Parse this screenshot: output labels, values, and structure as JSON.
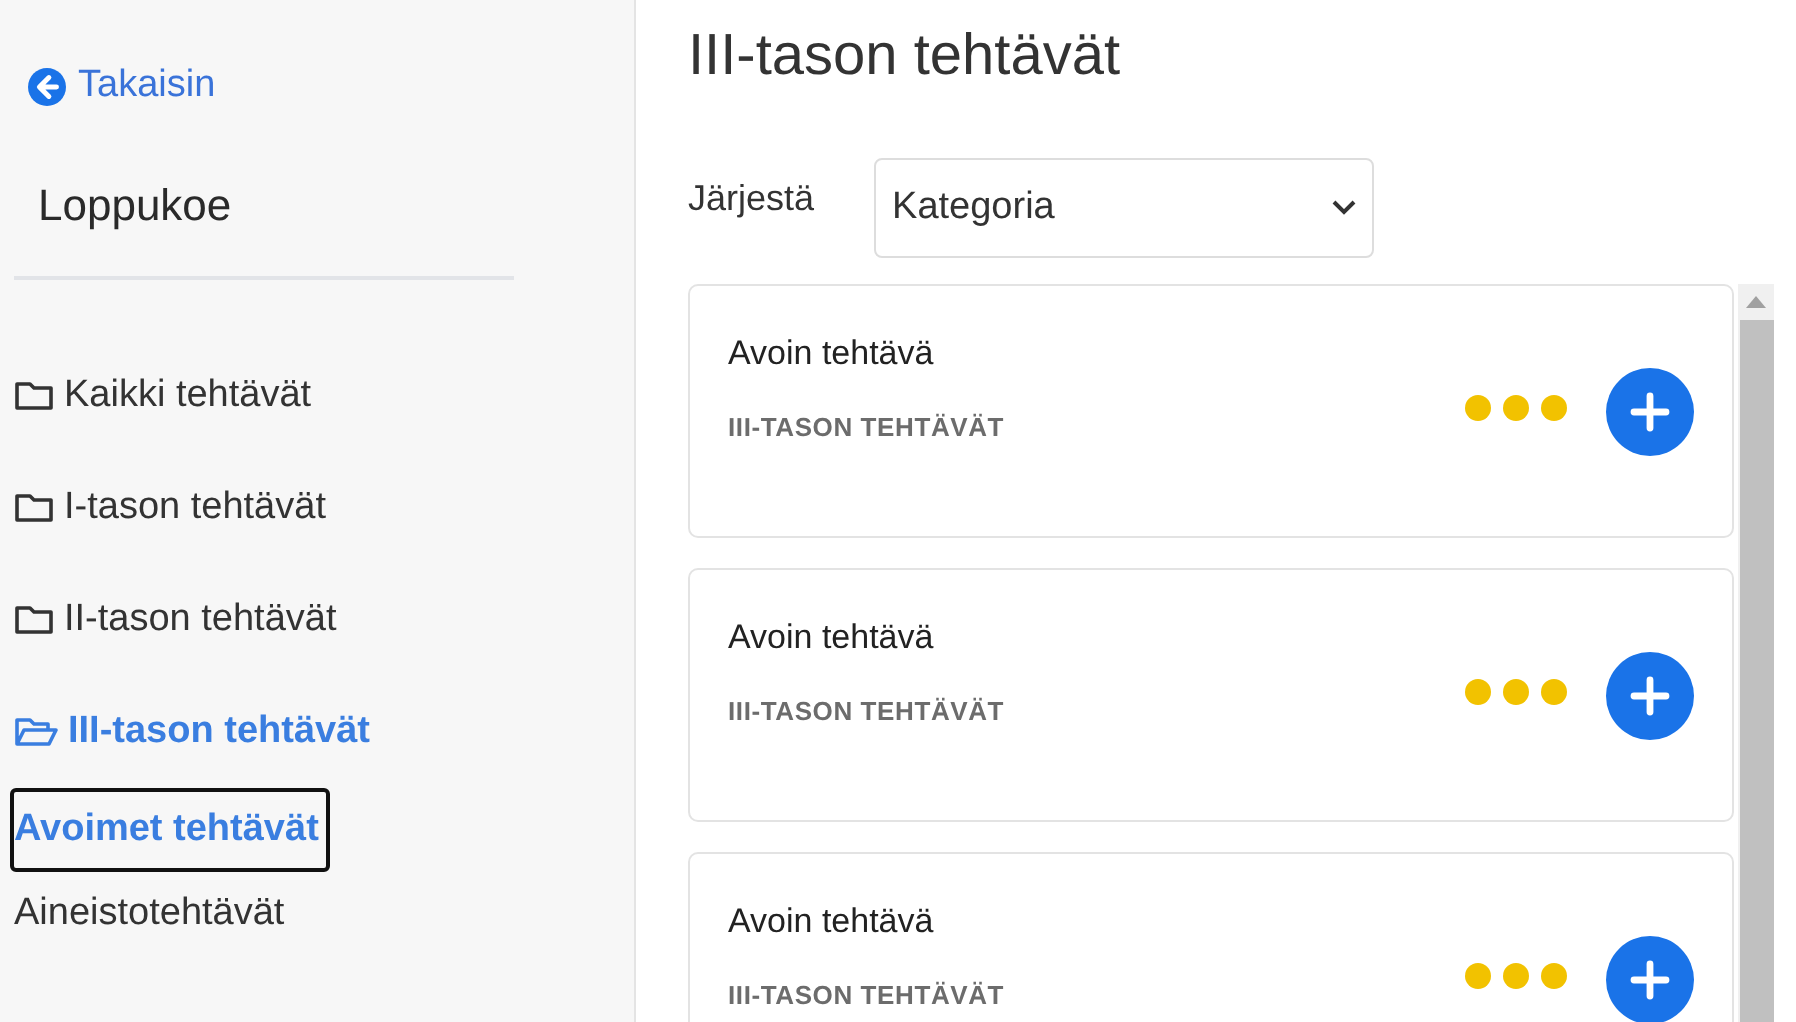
{
  "sidebar": {
    "back_link": "Takaisin",
    "exam_title": "Loppukoe",
    "tree": [
      {
        "label": "Kaikki tehtävät",
        "expanded": false,
        "selected": false
      },
      {
        "label": "I-tason tehtävät",
        "expanded": false,
        "selected": false
      },
      {
        "label": "II-tason tehtävät",
        "expanded": false,
        "selected": false
      },
      {
        "label": "III-tason tehtävät",
        "expanded": true,
        "selected": true,
        "children": [
          {
            "label": "Avoimet tehtävät",
            "selected": true
          },
          {
            "label": "Aineistotehtävät",
            "selected": false
          }
        ]
      }
    ]
  },
  "main": {
    "title": "III-tason tehtävät",
    "sort_label": "Järjestä",
    "sort_value": "Kategoria",
    "tasks": [
      {
        "title": "Avoin tehtävä",
        "category": "III-TASON TEHTÄVÄT"
      },
      {
        "title": "Avoin tehtävä",
        "category": "III-TASON TEHTÄVÄT"
      },
      {
        "title": "Avoin tehtävä",
        "category": "III-TASON TEHTÄVÄT"
      }
    ]
  }
}
